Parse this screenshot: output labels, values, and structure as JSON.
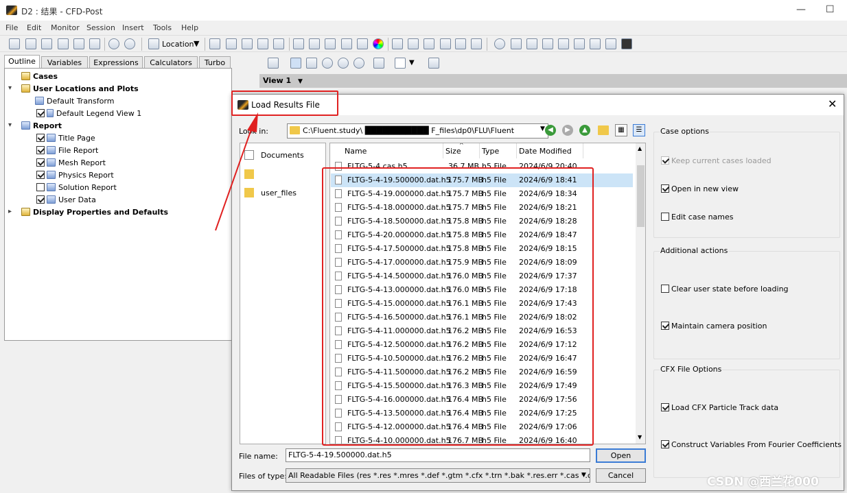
{
  "window": {
    "title": "D2 : 结果 - CFD-Post",
    "minimize": "—",
    "maximize": "☐"
  },
  "menu": [
    "File",
    "Edit",
    "Monitor",
    "Session",
    "Insert",
    "Tools",
    "Help"
  ],
  "toolbar": {
    "location_label": "Location"
  },
  "panel_tabs": [
    "Outline",
    "Variables",
    "Expressions",
    "Calculators",
    "Turbo"
  ],
  "tree": {
    "cases": "Cases",
    "user_locations": "User Locations and Plots",
    "default_transform": "Default Transform",
    "default_legend": "Default Legend View 1",
    "report": "Report",
    "report_items": [
      {
        "label": "Title Page",
        "checked": true
      },
      {
        "label": "File Report",
        "checked": true
      },
      {
        "label": "Mesh Report",
        "checked": true
      },
      {
        "label": "Physics Report",
        "checked": true
      },
      {
        "label": "Solution Report",
        "checked": false
      },
      {
        "label": "User Data",
        "checked": true
      }
    ],
    "display_props": "Display Properties and Defaults"
  },
  "viewer": {
    "view_label": "View 1"
  },
  "dialog": {
    "title": "Load Results File",
    "lookin_label": "Look in:",
    "lookin_path": "C:\\Fluent.study\\ ███████████ F_files\\dp0\\FLU\\Fluent",
    "places": [
      "Documents",
      "",
      "user_files"
    ],
    "columns": {
      "name": "Name",
      "size": "Size",
      "type": "Type",
      "date": "Date Modified"
    },
    "files": [
      {
        "name": "FLTG-5-4.cas.h5",
        "size": "36.7 MB",
        "type": "h5 File",
        "date": "2024/6/9 20:40"
      },
      {
        "name": "FLTG-5-4-19.500000.dat.h5",
        "size": "175.7 MB",
        "type": "h5 File",
        "date": "2024/6/9 18:41"
      },
      {
        "name": "FLTG-5-4-19.000000.dat.h5",
        "size": "175.7 MB",
        "type": "h5 File",
        "date": "2024/6/9 18:34"
      },
      {
        "name": "FLTG-5-4-18.000000.dat.h5",
        "size": "175.7 MB",
        "type": "h5 File",
        "date": "2024/6/9 18:21"
      },
      {
        "name": "FLTG-5-4-18.500000.dat.h5",
        "size": "175.8 MB",
        "type": "h5 File",
        "date": "2024/6/9 18:28"
      },
      {
        "name": "FLTG-5-4-20.000000.dat.h5",
        "size": "175.8 MB",
        "type": "h5 File",
        "date": "2024/6/9 18:47"
      },
      {
        "name": "FLTG-5-4-17.500000.dat.h5",
        "size": "175.8 MB",
        "type": "h5 File",
        "date": "2024/6/9 18:15"
      },
      {
        "name": "FLTG-5-4-17.000000.dat.h5",
        "size": "175.9 MB",
        "type": "h5 File",
        "date": "2024/6/9 18:09"
      },
      {
        "name": "FLTG-5-4-14.500000.dat.h5",
        "size": "176.0 MB",
        "type": "h5 File",
        "date": "2024/6/9 17:37"
      },
      {
        "name": "FLTG-5-4-13.000000.dat.h5",
        "size": "176.0 MB",
        "type": "h5 File",
        "date": "2024/6/9 17:18"
      },
      {
        "name": "FLTG-5-4-15.000000.dat.h5",
        "size": "176.1 MB",
        "type": "h5 File",
        "date": "2024/6/9 17:43"
      },
      {
        "name": "FLTG-5-4-16.500000.dat.h5",
        "size": "176.1 MB",
        "type": "h5 File",
        "date": "2024/6/9 18:02"
      },
      {
        "name": "FLTG-5-4-11.000000.dat.h5",
        "size": "176.2 MB",
        "type": "h5 File",
        "date": "2024/6/9 16:53"
      },
      {
        "name": "FLTG-5-4-12.500000.dat.h5",
        "size": "176.2 MB",
        "type": "h5 File",
        "date": "2024/6/9 17:12"
      },
      {
        "name": "FLTG-5-4-10.500000.dat.h5",
        "size": "176.2 MB",
        "type": "h5 File",
        "date": "2024/6/9 16:47"
      },
      {
        "name": "FLTG-5-4-11.500000.dat.h5",
        "size": "176.2 MB",
        "type": "h5 File",
        "date": "2024/6/9 16:59"
      },
      {
        "name": "FLTG-5-4-15.500000.dat.h5",
        "size": "176.3 MB",
        "type": "h5 File",
        "date": "2024/6/9 17:49"
      },
      {
        "name": "FLTG-5-4-16.000000.dat.h5",
        "size": "176.4 MB",
        "type": "h5 File",
        "date": "2024/6/9 17:56"
      },
      {
        "name": "FLTG-5-4-13.500000.dat.h5",
        "size": "176.4 MB",
        "type": "h5 File",
        "date": "2024/6/9 17:25"
      },
      {
        "name": "FLTG-5-4-12.000000.dat.h5",
        "size": "176.4 MB",
        "type": "h5 File",
        "date": "2024/6/9 17:06"
      },
      {
        "name": "FLTG-5-4-10.000000.dat.h5",
        "size": "176.7 MB",
        "type": "h5 File",
        "date": "2024/6/9 16:40"
      }
    ],
    "selected_file_index": 1,
    "filename_label": "File name:",
    "filename_value": "FLTG-5-4-19.500000.dat.h5",
    "filetypes_label": "Files of type:",
    "filetypes_value": "All Readable Files (res *.res *.mres *.def *.gtm *.cfx *.trn *.bak *.res.err *.cas *.cas",
    "open_label": "Open",
    "cancel_label": "Cancel",
    "case_options": {
      "title": "Case options",
      "keep_current": "Keep current cases loaded",
      "open_new_view": "Open in new view",
      "edit_case_names": "Edit case names"
    },
    "additional_actions": {
      "title": "Additional actions",
      "clear_user_state": "Clear user state before loading",
      "maintain_camera": "Maintain camera position"
    },
    "cfx_options": {
      "title": "CFX File Options",
      "load_particle": "Load CFX Particle Track data",
      "construct_fourier": "Construct Variables From Fourier Coefficients"
    }
  },
  "watermark": "CSDN @西兰花000",
  "colors": {
    "highlight": "#e02020",
    "selection": "#cce4f7",
    "accent": "#3a7bd5"
  }
}
